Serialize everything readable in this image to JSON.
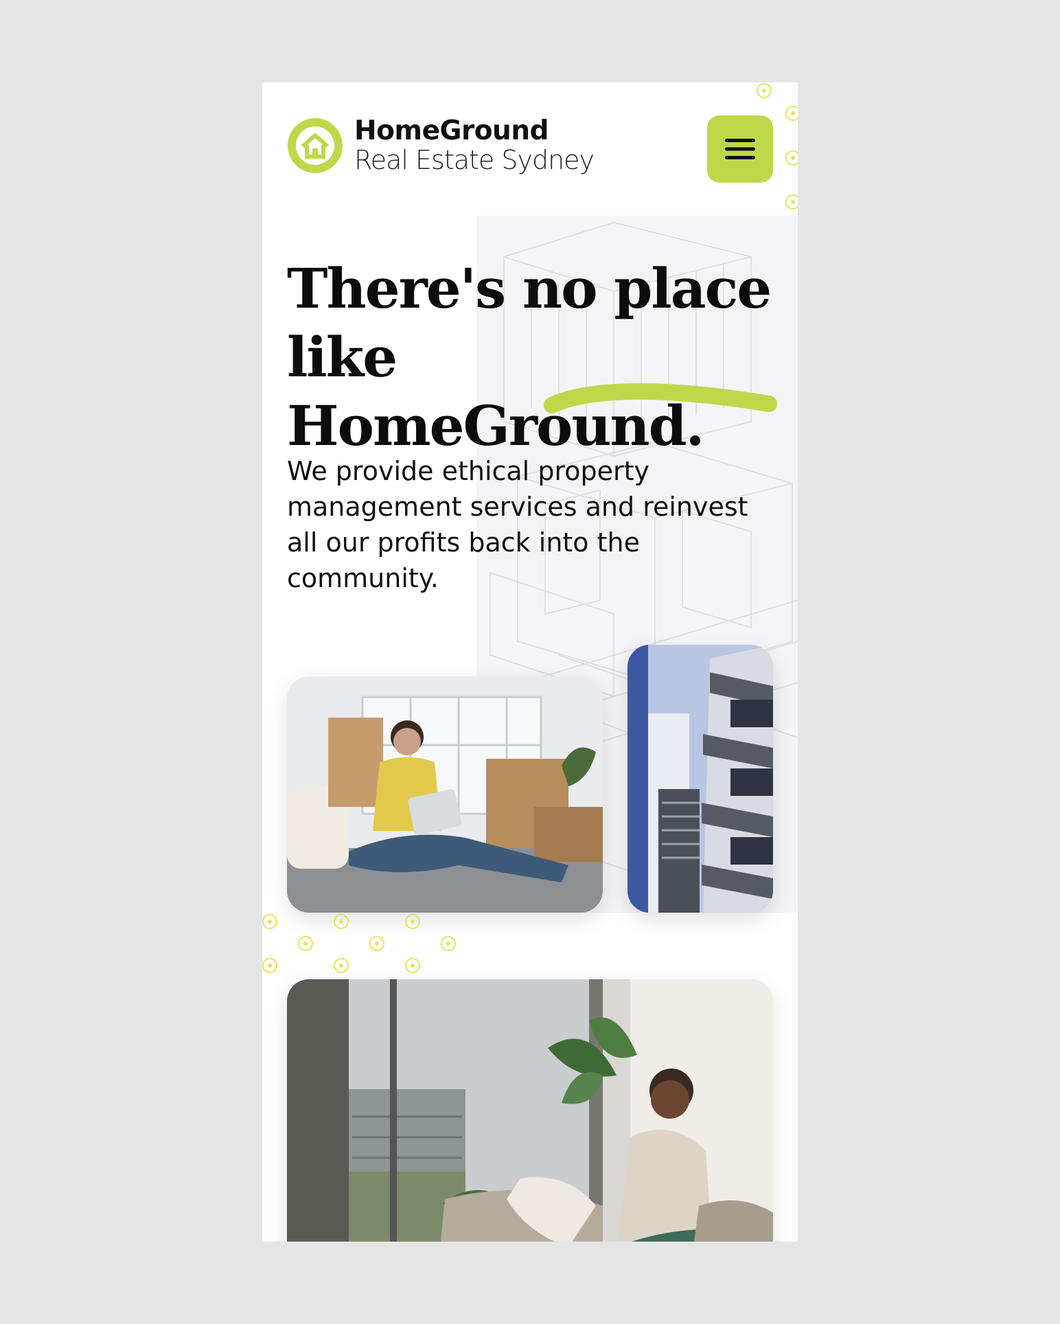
{
  "header": {
    "logo_name": "HomeGround",
    "logo_sub": "Real Estate Sydney",
    "menu_icon": "hamburger-menu-icon"
  },
  "hero": {
    "title_line1": "There's no place",
    "title_line2": "like HomeGround.",
    "description": "We provide ethical property management services and reinvest all our profits back into the community."
  },
  "images": [
    {
      "name": "woman-with-laptop-moving-boxes-photo"
    },
    {
      "name": "apartment-building-photo"
    },
    {
      "name": "woman-on-sofa-with-plant-photo"
    }
  ],
  "colors": {
    "accent": "#bfd84a",
    "dots": "#e8e25a",
    "text": "#0c0c0c",
    "page_bg": "#e5e5e5"
  }
}
